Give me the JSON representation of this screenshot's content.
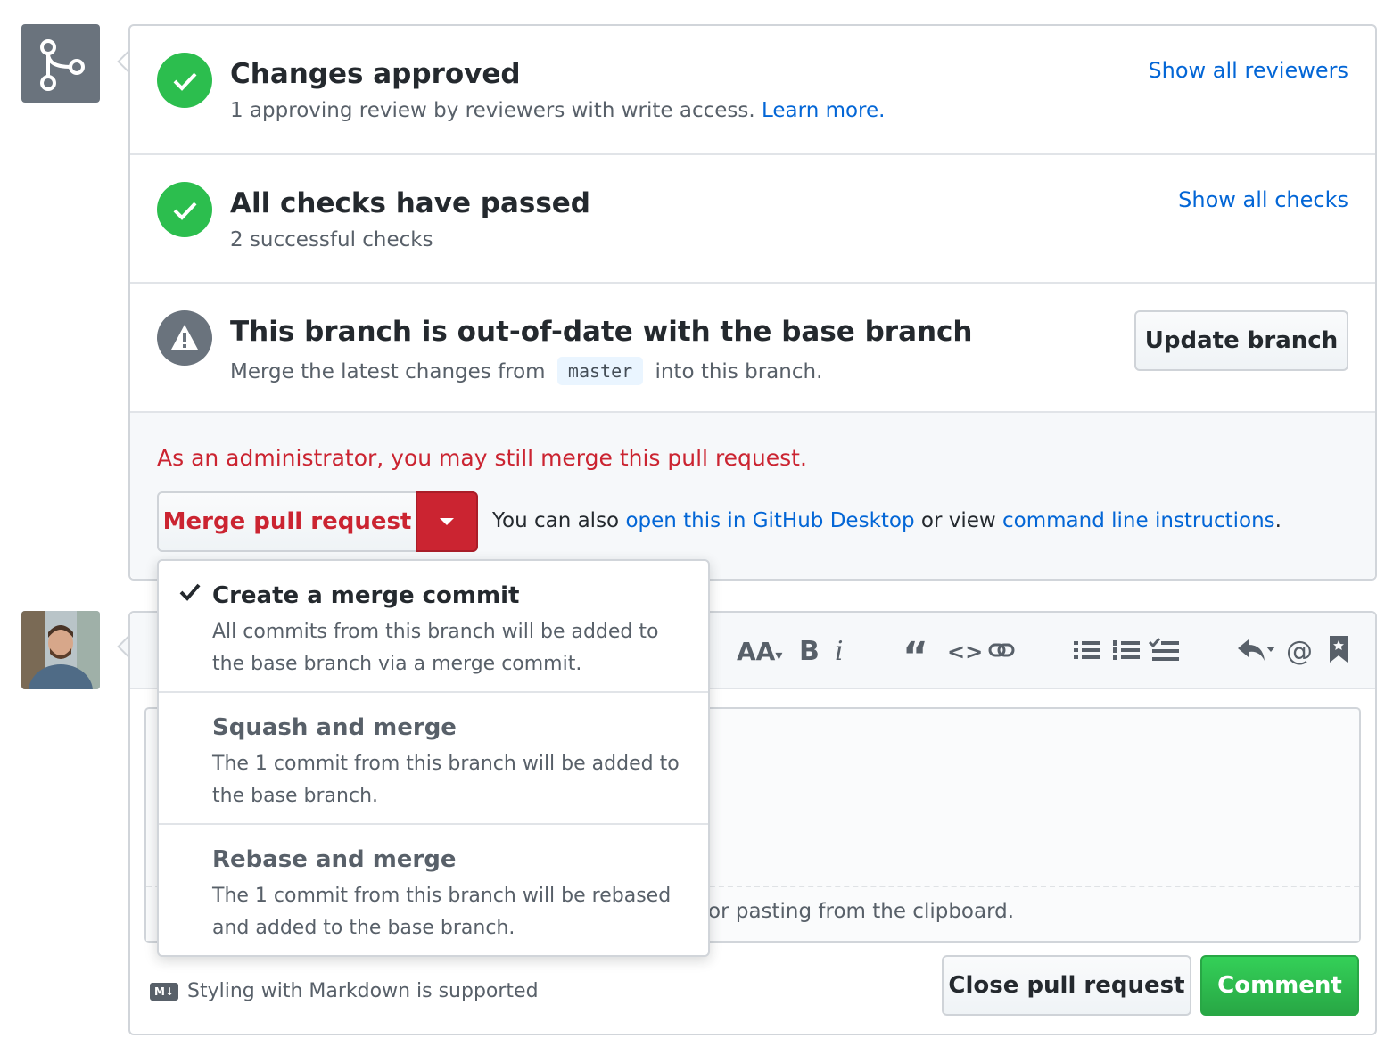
{
  "merge_status": {
    "approved": {
      "title": "Changes approved",
      "subtitle": "1 approving review by reviewers with write access.",
      "learn_more": "Learn more.",
      "link": "Show all reviewers"
    },
    "checks": {
      "title": "All checks have passed",
      "subtitle": "2 successful checks",
      "link": "Show all checks"
    },
    "outdated": {
      "title": "This branch is out-of-date with the base branch",
      "subtitle_pre": "Merge the latest changes from",
      "branch": "master",
      "subtitle_post": "into this branch.",
      "button": "Update branch"
    },
    "admin": {
      "message": "As an administrator, you may still merge this pull request.",
      "merge_button": "Merge pull request",
      "also_pre": "You can also",
      "desktop_link": "open this in GitHub Desktop",
      "also_mid": "or view",
      "cli_link": "command line instructions",
      "also_post": "."
    }
  },
  "merge_menu": {
    "items": [
      {
        "title": "Create a merge commit",
        "description": "All commits from this branch will be added to the base branch via a merge commit.",
        "selected": true
      },
      {
        "title": "Squash and merge",
        "description": "The 1 commit from this branch will be added to the base branch.",
        "selected": false
      },
      {
        "title": "Rebase and merge",
        "description": "The 1 commit from this branch will be rebased and added to the base branch.",
        "selected": false
      }
    ]
  },
  "comment": {
    "toolbar": {
      "heading": "AA",
      "bold": "B",
      "italic": "i",
      "quote": "“",
      "code": "<>",
      "mention": "@"
    },
    "drop_hint": "or pasting from the clipboard.",
    "markdown_note": "Styling with Markdown is supported",
    "markdown_badge": "M↓",
    "close_button": "Close pull request",
    "comment_button": "Comment"
  },
  "colors": {
    "success": "#2cbe4e",
    "danger": "#cb2431",
    "link": "#0366d6",
    "neutral_icon": "#6a737d"
  },
  "icons": [
    "git-merge-icon",
    "check-circle-icon",
    "alert-icon",
    "triangle-down-icon",
    "check-icon",
    "markdown-icon",
    "reply-icon",
    "bookmark-icon"
  ]
}
